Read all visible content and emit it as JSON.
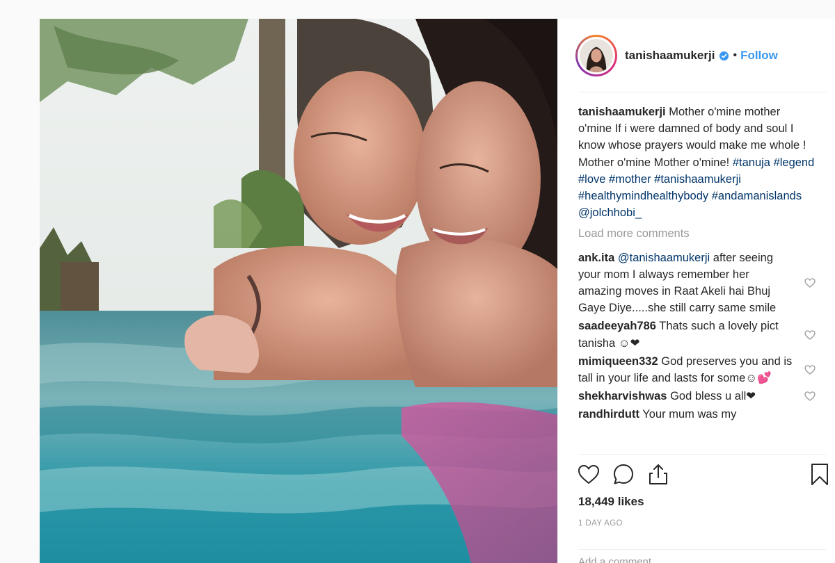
{
  "header": {
    "username": "tanishaamukerji",
    "separator": "•",
    "follow_label": "Follow"
  },
  "caption": {
    "username": "tanishaamukerji",
    "text": "Mother o'mine mother o'mine If i were damned of body and soul I know whose prayers would make me whole ! Mother o'mine Mother o'mine!",
    "tags": [
      "#tanuja",
      "#legend",
      "#love",
      "#mother",
      "#tanishaamukerji",
      "#healthymindhealthybody",
      "#andamanislands",
      "@jolchhobi_"
    ]
  },
  "load_more_label": "Load more comments",
  "comments": [
    {
      "username": "ank.ita",
      "mention": "@tanishaamukerji",
      "text": "after seeing your mom I always remember her amazing moves in Raat Akeli hai Bhuj Gaye Diye.....she still carry same smile"
    },
    {
      "username": "saadeeyah786",
      "text": "Thats such a lovely pict tanisha ☺❤"
    },
    {
      "username": "mimiqueen332",
      "text": "God preserves you and is tall in your life and lasts for some☺💕"
    },
    {
      "username": "shekharvishwas",
      "text": "God bless u all❤"
    },
    {
      "username": "randhirdutt",
      "text": "Your mum was my"
    }
  ],
  "actions": {
    "like_icon": "heart-icon",
    "comment_icon": "comment-icon",
    "share_icon": "share-icon",
    "save_icon": "bookmark-icon"
  },
  "likes_label": "18,449 likes",
  "time_ago": "1 DAY AGO",
  "add_comment_placeholder": "Add a comment...",
  "colors": {
    "link": "#3897f0",
    "hashtag": "#003569",
    "muted": "#999999",
    "text": "#262626"
  }
}
